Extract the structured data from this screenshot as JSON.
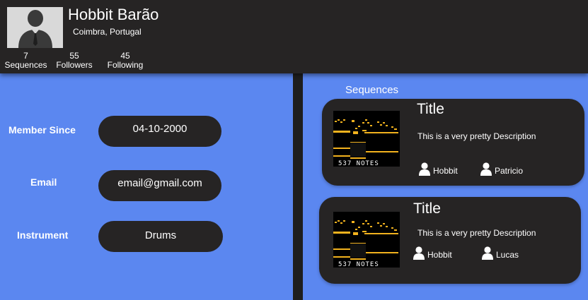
{
  "profile": {
    "name": "Hobbit Barão",
    "location": "Coimbra, Portugal",
    "avatar_icon": "user-silhouette-icon"
  },
  "stats": [
    {
      "count": "7",
      "label": "Sequences"
    },
    {
      "count": "55",
      "label": "Followers"
    },
    {
      "count": "45",
      "label": "Following"
    }
  ],
  "info": {
    "member_since": {
      "label": "Member Since",
      "value": "04-10-2000"
    },
    "email": {
      "label": "Email",
      "value": "email@gmail.com"
    },
    "instrument": {
      "label": "Instrument",
      "value": "Drums"
    }
  },
  "sequences": {
    "heading": "Sequences",
    "items": [
      {
        "title": "Title",
        "description": "This is a very pretty Description",
        "thumbnail_caption": "537 NOTES",
        "users": [
          "Hobbit",
          "Patricio"
        ]
      },
      {
        "title": "Title",
        "description": "This is a very pretty Description",
        "thumbnail_caption": "537 NOTES",
        "users": [
          "Hobbit",
          "Lucas"
        ]
      }
    ]
  },
  "colors": {
    "background": "#5b87f0",
    "panel": "#262424",
    "divider": "#1e1e1e",
    "note": "#f2b21e",
    "text": "#ffffff"
  }
}
